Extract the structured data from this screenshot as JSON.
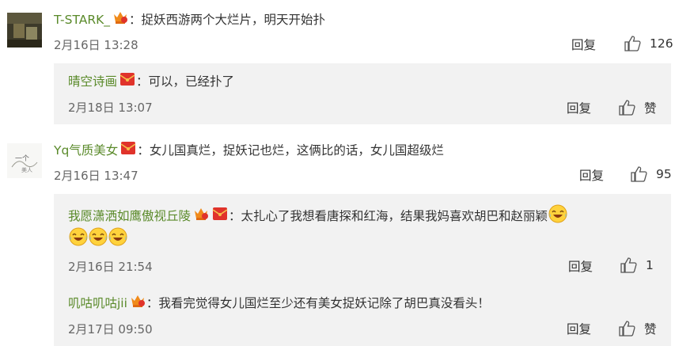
{
  "comments": [
    {
      "user": "T-STARK_",
      "text": "：捉妖西游两个大烂片，明天开始扑",
      "time": "2月16日 13:28",
      "reply": "回复",
      "likes": "126",
      "replies": [
        {
          "user": "晴空诗画",
          "text": "：可以，已经扑了",
          "time": "2月18日 13:07",
          "reply": "回复",
          "likes": "赞"
        }
      ]
    },
    {
      "user": "Yq气质美女",
      "text": "：女儿国真烂，捉妖记也烂，这俩比的话，女儿国超级烂",
      "time": "2月16日 13:47",
      "reply": "回复",
      "likes": "95",
      "replies": [
        {
          "user": "我愿潇洒如鹰傲视丘陵",
          "text": "：太扎心了我想看唐探和红海，结果我妈喜欢胡巴和赵丽颖",
          "time": "2月16日 21:54",
          "reply": "回复",
          "likes": "1"
        },
        {
          "user": "叽咕叽咕jii",
          "text": "：我看完觉得女儿国烂至少还有美女捉妖记除了胡巴真没看头！",
          "time": "2月17日 09:50",
          "reply": "回复",
          "likes": "赞"
        }
      ]
    }
  ],
  "icons": {
    "thumb": "thumbs-up-icon",
    "vip": "crown-vip-icon",
    "redpacket": "red-envelope-icon",
    "laugh": "laughing-crying-emoji"
  },
  "colors": {
    "username": "#5a8a2a",
    "reply_bg": "#f2f2f2",
    "badge_orange": "#f08a1a",
    "badge_red": "#e0332b"
  }
}
